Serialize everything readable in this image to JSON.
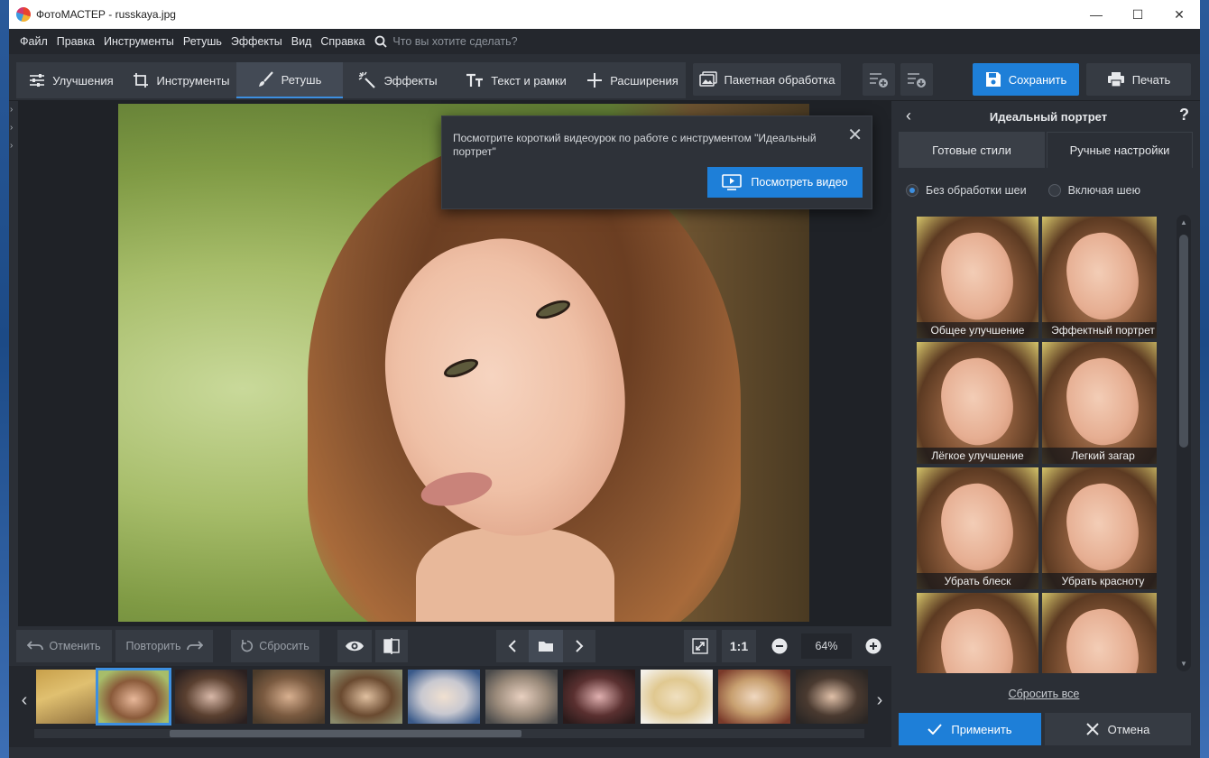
{
  "window": {
    "title": "ФотоМАСТЕР - russkaya.jpg",
    "controls": {
      "minimize": "—",
      "maximize": "☐",
      "close": "✕"
    }
  },
  "menu": {
    "items": [
      "Файл",
      "Правка",
      "Инструменты",
      "Ретушь",
      "Эффекты",
      "Вид",
      "Справка"
    ],
    "search_placeholder": "Что вы хотите сделать?"
  },
  "toolbar": {
    "tabs": [
      {
        "label": "Улучшения",
        "icon": "sliders-icon"
      },
      {
        "label": "Инструменты",
        "icon": "crop-icon"
      },
      {
        "label": "Ретушь",
        "icon": "brush-icon",
        "active": true
      },
      {
        "label": "Эффекты",
        "icon": "magic-wand-icon"
      },
      {
        "label": "Текст и рамки",
        "icon": "text-icon"
      },
      {
        "label": "Расширения",
        "icon": "plus-icon"
      }
    ],
    "batch_label": "Пакетная обработка",
    "save_label": "Сохранить",
    "print_label": "Печать"
  },
  "popup": {
    "message": "Посмотрите короткий видеоурок по работе с инструментом \"Идеальный портрет\"",
    "button_label": "Посмотреть видео"
  },
  "controls": {
    "undo_label": "Отменить",
    "redo_label": "Повторить",
    "reset_label": "Сбросить",
    "one_to_one": "1:1",
    "zoom": "64%"
  },
  "right_panel": {
    "title": "Идеальный портрет",
    "help": "?",
    "tabs": [
      "Готовые стили",
      "Ручные настройки"
    ],
    "radio_options": [
      {
        "label": "Без обработки шеи",
        "selected": true
      },
      {
        "label": "Включая шею",
        "selected": false
      }
    ],
    "styles": [
      "Общее улучшение",
      "Эффектный портрет",
      "Лёгкое улучшение",
      "Легкий загар",
      "Убрать блеск",
      "Убрать красноту",
      "",
      ""
    ],
    "reset_all": "Сбросить все",
    "apply_label": "Применить",
    "cancel_label": "Отмена"
  },
  "colors": {
    "accent": "#1e7fd8",
    "panel_bg": "#2b2f36",
    "canvas_bg": "#1f2227"
  }
}
